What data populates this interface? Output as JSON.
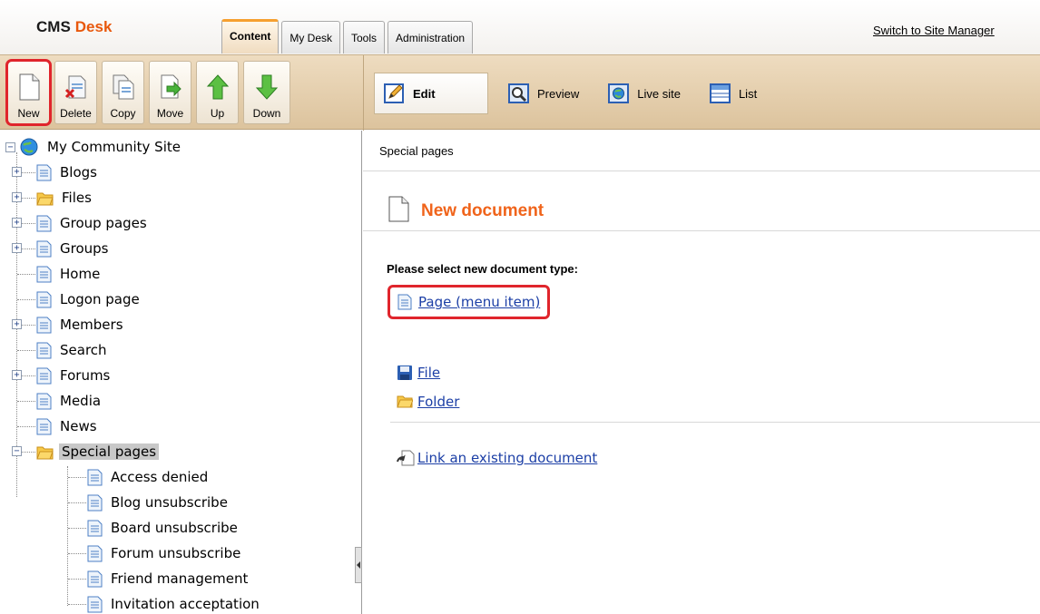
{
  "app": {
    "brand_part1": "CMS",
    "brand_part2": "Desk"
  },
  "tabs": [
    {
      "label": "Content",
      "active": true
    },
    {
      "label": "My Desk",
      "active": false
    },
    {
      "label": "Tools",
      "active": false
    },
    {
      "label": "Administration",
      "active": false
    }
  ],
  "switch_link": "Switch to Site Manager",
  "toolbar": {
    "new": "New",
    "delete": "Delete",
    "copy": "Copy",
    "move": "Move",
    "up": "Up",
    "down": "Down"
  },
  "view_modes": {
    "edit": "Edit",
    "preview": "Preview",
    "live_site": "Live site",
    "list": "List"
  },
  "tree": {
    "root": "My Community Site",
    "items": [
      "Blogs",
      "Files",
      "Group pages",
      "Groups",
      "Home",
      "Logon page",
      "Members",
      "Search",
      "Forums",
      "Media",
      "News",
      "Special pages"
    ],
    "special_children": [
      "Access denied",
      "Blog unsubscribe",
      "Board unsubscribe",
      "Forum unsubscribe",
      "Friend management",
      "Invitation acceptation"
    ],
    "selected": "Special pages"
  },
  "content": {
    "breadcrumb": "Special pages",
    "title": "New document",
    "select_label": "Please select new document type:",
    "page_link": "Page (menu item)",
    "file_link": "File",
    "folder_link": "Folder",
    "link_existing": "Link an existing document"
  },
  "colors": {
    "accent_orange": "#f0641b",
    "highlight_red": "#e0252c",
    "toolbar_tan": "#e6cfac",
    "link_blue": "#1c3fa6"
  },
  "icons": {
    "toolbar": [
      "new-document-icon",
      "delete-document-icon",
      "copy-document-icon",
      "move-document-icon",
      "arrow-up-icon",
      "arrow-down-icon"
    ],
    "modes": [
      "edit-pencil-icon",
      "preview-magnifier-icon",
      "globe-icon",
      "list-icon"
    ],
    "tree": [
      "globe-icon",
      "page-icon",
      "folder-icon"
    ],
    "content": [
      "new-document-icon",
      "page-icon",
      "floppy-disk-icon",
      "folder-icon",
      "link-document-icon"
    ]
  }
}
